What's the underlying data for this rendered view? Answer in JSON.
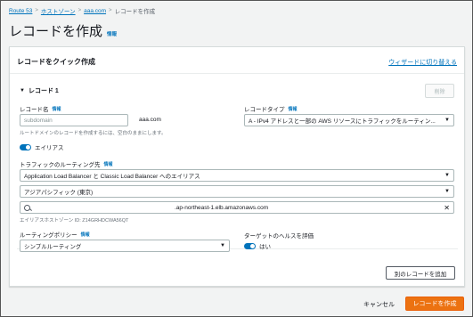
{
  "breadcrumb": {
    "items": [
      "Route 53",
      "ホストゾーン",
      "aaa.com",
      "レコードを作成"
    ]
  },
  "page": {
    "title": "レコードを作成",
    "info": "情報"
  },
  "panel": {
    "title": "レコードをクイック作成",
    "wizard_link": "ウィザードに切り替える"
  },
  "record": {
    "heading": "レコード 1",
    "delete_label": "削除",
    "record_name": {
      "label": "レコード名",
      "info": "情報",
      "placeholder": "subdomain",
      "suffix": "aaa.com",
      "hint": "ルートドメインのレコードを作成するには、空白のままにします。"
    },
    "record_type": {
      "label": "レコードタイプ",
      "info": "情報",
      "value": "A - IPv4 アドレスと一部の AWS リソースにトラフィックをルーティン..."
    },
    "alias": {
      "label": "エイリアス",
      "on": true
    },
    "routing_target": {
      "label": "トラフィックのルーティング先",
      "info": "情報",
      "endpoint_type": "Application Load Balancer と Classic Load Balancer へのエイリアス",
      "region": "アジアパシフィック (東京)",
      "load_balancer": ".ap-northeast-1.elb.amazonaws.com",
      "hosted_zone_hint": "エイリアスホストゾーン ID: Z14GRHDCWA56QT"
    },
    "routing_policy": {
      "label": "ルーティングポリシー",
      "info": "情報",
      "value": "シンプルルーティング"
    },
    "health": {
      "label": "ターゲットのヘルスを評価",
      "value": "はい",
      "on": true
    }
  },
  "actions": {
    "add_record": "別のレコードを追加",
    "cancel": "キャンセル",
    "create": "レコードを作成"
  },
  "colors": {
    "link": "#0073bb",
    "primary_button": "#ec7211",
    "toggle_on": "#0073bb"
  }
}
